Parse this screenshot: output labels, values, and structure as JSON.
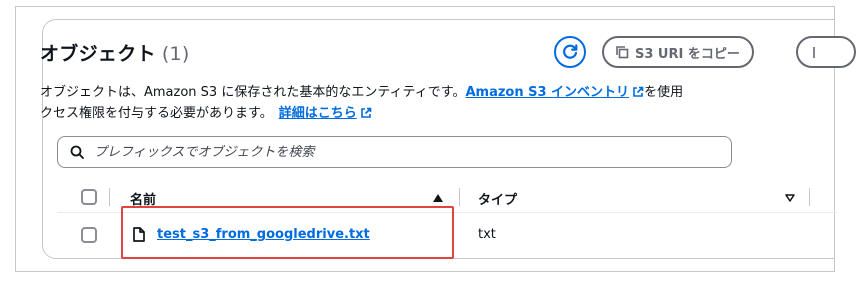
{
  "header": {
    "title": "オブジェクト",
    "count": "(1)"
  },
  "toolbar": {
    "s3_uri_label": "S3 URI をコピー"
  },
  "description": {
    "line1_text": "オブジェクトは、Amazon S3 に保存された基本的なエンティティです。",
    "inventory_link": "Amazon S3 インベントリ",
    "line1_tail": "を使用",
    "line2_text": "クセス権限を付与する必要があります。",
    "details_link": "詳細はこちら"
  },
  "search": {
    "placeholder": "プレフィックスでオブジェクトを検索"
  },
  "table": {
    "columns": [
      {
        "label": "名前",
        "sort": "ascending"
      },
      {
        "label": "タイプ",
        "sort": "none"
      }
    ],
    "rows": [
      {
        "name": "test_s3_from_googledrive.txt",
        "type": "txt"
      }
    ]
  },
  "colors": {
    "accent": "#006ce0",
    "highlight": "#e0443e",
    "border": "#c6c6cd"
  },
  "icons": [
    "refresh-icon",
    "copy-icon",
    "external-link-icon",
    "search-icon",
    "sort-asc-icon",
    "sort-none-icon",
    "file-icon"
  ]
}
